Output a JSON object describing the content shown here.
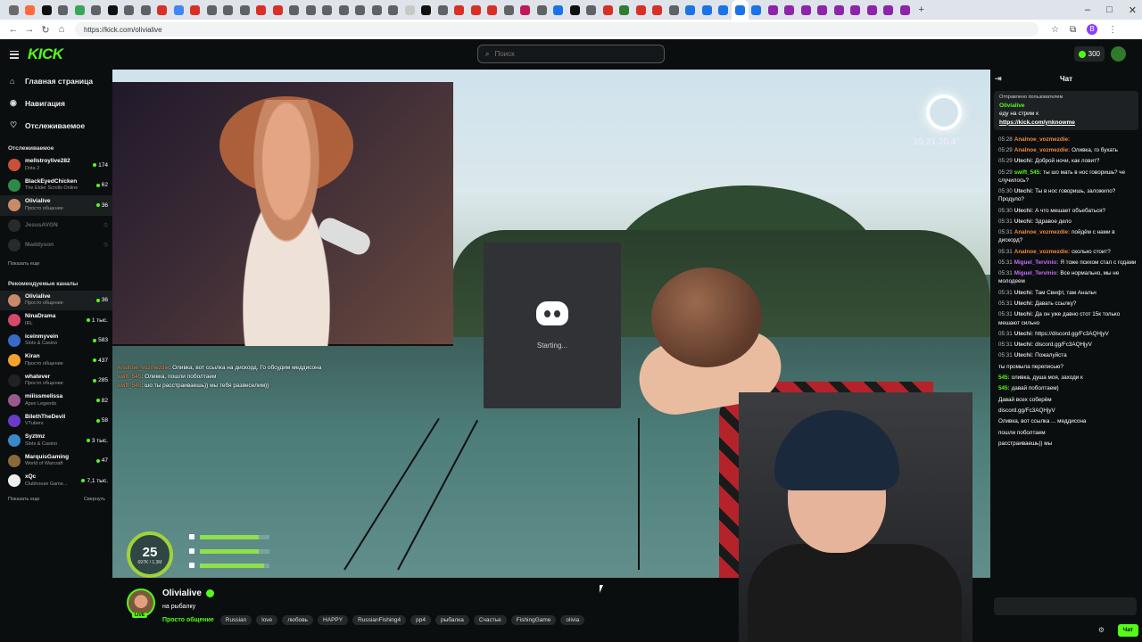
{
  "browser": {
    "tab_colors": [
      "#6b6b6b",
      "#ff6a3d",
      "#111111",
      "#5f6368",
      "#3aa657",
      "#5f6368",
      "#111111",
      "#5f6368",
      "#5f6368",
      "#d93025",
      "#4285f4",
      "#d93025",
      "#5f6368",
      "#5f6368",
      "#5f6368",
      "#d93025",
      "#d93025",
      "#5f6368",
      "#5f6368",
      "#5f6368",
      "#5f6368",
      "#5f6368",
      "#5f6368",
      "#5f6368",
      "#c8c8c8",
      "#111111",
      "#5f6368",
      "#d93025",
      "#d93025",
      "#d93025",
      "#5f6368",
      "#c2185b",
      "#5f6368",
      "#1a73e8",
      "#111111",
      "#5f6368",
      "#d93025",
      "#2e7d32",
      "#d93025",
      "#d93025",
      "#5f6368",
      "#1a73e8",
      "#1a73e8",
      "#1a73e8",
      "#1a73e8",
      "#1a73e8",
      "#8e24aa",
      "#8e24aa",
      "#8e24aa",
      "#8e24aa",
      "#8e24aa",
      "#8e24aa",
      "#8e24aa",
      "#8e24aa",
      "#8e24aa"
    ],
    "active_tab_index": 44,
    "new_tab_label": "+",
    "url": "https://kick.com/olivialive"
  },
  "header": {
    "logo": "KICK",
    "search_placeholder": "Поиск",
    "coins": "300"
  },
  "sidebar": {
    "nav": [
      {
        "label": "Главная страница",
        "icon": "home-icon"
      },
      {
        "label": "Навигация",
        "icon": "compass-icon"
      },
      {
        "label": "Отслеживаемое",
        "icon": "heart-icon"
      }
    ],
    "following_title": "Отслеживаемое",
    "following": [
      {
        "name": "mellstroylive282",
        "game": "Dota 2",
        "viewers": "174",
        "color": "#c9503a",
        "offline": false,
        "selected": false
      },
      {
        "name": "BlackEyedChicken",
        "game": "The Elder Scrolls Online",
        "viewers": "62",
        "color": "#2f8a4a",
        "offline": false,
        "selected": false
      },
      {
        "name": "Olivialive",
        "game": "Просто общение",
        "viewers": "36",
        "color": "#c98a6a",
        "offline": false,
        "selected": true
      },
      {
        "name": "JesusAVGN",
        "game": "",
        "viewers": "",
        "color": "#555555",
        "offline": true,
        "selected": false
      },
      {
        "name": "Maddyson",
        "game": "",
        "viewers": "",
        "color": "#555555",
        "offline": true,
        "selected": false
      }
    ],
    "show_more": "Показать еще",
    "recommended_title": "Рекомендуемые каналы",
    "recommended": [
      {
        "name": "Olivialive",
        "game": "Просто общение",
        "viewers": "36",
        "color": "#c98a6a",
        "selected": true
      },
      {
        "name": "NinaDrama",
        "game": "IRL",
        "viewers": "1 тыс.",
        "color": "#d44a6a",
        "selected": false
      },
      {
        "name": "iceinmyvein",
        "game": "Slots & Casino",
        "viewers": "583",
        "color": "#3a6ac9",
        "selected": false
      },
      {
        "name": "Kiran",
        "game": "Просто общение",
        "viewers": "437",
        "color": "#f2a22e",
        "selected": false
      },
      {
        "name": "whatever",
        "game": "Просто общение",
        "viewers": "285",
        "color": "#222222",
        "selected": false
      },
      {
        "name": "miiissmelissa",
        "game": "Apex Legends",
        "viewers": "82",
        "color": "#9a5a8a",
        "selected": false
      },
      {
        "name": "BilethTheDevil",
        "game": "VTubers",
        "viewers": "58",
        "color": "#6a3ac9",
        "selected": false
      },
      {
        "name": "Syztmz",
        "game": "Slots & Casino",
        "viewers": "3 тыс.",
        "color": "#3a8ac9",
        "selected": false
      },
      {
        "name": "MarquisGaming",
        "game": "World of Warcraft",
        "viewers": "47",
        "color": "#8a6a3a",
        "selected": false
      },
      {
        "name": "xQc",
        "game": "Clubhouse Game...",
        "viewers": "7,1 тыс.",
        "color": "#eeeeee",
        "selected": false
      }
    ],
    "show_more_2": "Показать еще",
    "collapse": "Свернуть"
  },
  "player": {
    "overlay_chat": [
      {
        "user": "Analnoe_vozmezdie",
        "text": ": Оливка, вот ссылка на дискорд. Го обсудим меддисона"
      },
      {
        "user": "swift_545",
        "text": ": Оливка, пошли поболтаем"
      },
      {
        "user": "swift_545",
        "text": ": шо ты расстраиваешь)) мы тебя развеселим))"
      }
    ],
    "discord_status": "Starting...",
    "game_time": "15:21",
    "game_temp": "20,4°",
    "hud_level": "25",
    "hud_sub": "697K / 1,3M",
    "hud_bars": [
      {
        "name": "energy",
        "icon": "bolt-icon",
        "fill": 0.85
      },
      {
        "name": "food",
        "icon": "fork-icon",
        "fill": 0.85
      },
      {
        "name": "health",
        "icon": "heart-icon",
        "fill": 0.92
      }
    ]
  },
  "stream_info": {
    "name": "Olivialive",
    "live_badge": "LIVE",
    "title": "на рыбалку",
    "category": "Просто общение",
    "tags": [
      "Russian",
      "love",
      "любовь",
      "HAPPY",
      "RussianFishing4",
      "pp4",
      "рыбалка",
      "Счастье",
      "FishingGame",
      "olivia"
    ]
  },
  "chat": {
    "title": "Чат",
    "pinned_header": "Отправлено пользователем",
    "pinned_user": "Olivialive",
    "pinned_text": "еду на стрим к",
    "pinned_link": "https://kick.com/ynknowme",
    "messages": [
      {
        "time": "05:28",
        "user": "Analnoe_vozmezdie",
        "color": "#f08a3a",
        "text": ""
      },
      {
        "time": "05:29",
        "user": "Analnoe_vozmezdie",
        "color": "#f08a3a",
        "text": "Оливка, го бухать"
      },
      {
        "time": "05:29",
        "user": "Utechi",
        "color": "#dddddd",
        "text": "Доброй ночи, как ловит?"
      },
      {
        "time": "05:29",
        "user": "swift_545",
        "color": "#53fc18",
        "text": "ты шо мать в нос говоришь? че случилось?"
      },
      {
        "time": "05:30",
        "user": "Utechi",
        "color": "#dddddd",
        "text": "Ты в нос говоришь, заложило? Продуло?"
      },
      {
        "time": "05:30",
        "user": "Utechi",
        "color": "#dddddd",
        "text": "А что мешает объебаться?"
      },
      {
        "time": "05:31",
        "user": "Utechi",
        "color": "#dddddd",
        "text": "Здравое дело"
      },
      {
        "time": "05:31",
        "user": "Analnoe_vozmezdie",
        "color": "#f08a3a",
        "text": "пойдём с нами в дискорд?"
      },
      {
        "time": "05:31",
        "user": "Analnoe_vozmezdie",
        "color": "#f08a3a",
        "text": "сколько стоит?"
      },
      {
        "time": "05:31",
        "user": "Miguel_Tervinio",
        "color": "#c86bff",
        "text": "Я тоже психом стал с годами"
      },
      {
        "time": "05:31",
        "user": "Miguel_Tervinio",
        "color": "#c86bff",
        "text": "Все нормально, мы не молодеем"
      },
      {
        "time": "05:31",
        "user": "Utechi",
        "color": "#dddddd",
        "text": "Там Свифт, там Анальч"
      },
      {
        "time": "05:31",
        "user": "Utechi",
        "color": "#dddddd",
        "text": "Давать ссылку?"
      },
      {
        "time": "05:31",
        "user": "Utechi",
        "color": "#dddddd",
        "text": "Да он уже давно стот 15к только мешают сильно"
      },
      {
        "time": "05:31",
        "user": "Utechi",
        "color": "#dddddd",
        "text": "https://discord.gg/Fc3AQHjyV"
      },
      {
        "time": "05:31",
        "user": "Utechi",
        "color": "#dddddd",
        "text": "discord.gg/Fc3AQHjyV"
      },
      {
        "time": "05:31",
        "user": "Utechi",
        "color": "#dddddd",
        "text": "Пожалуйста"
      },
      {
        "time": "",
        "user": "",
        "color": "#dddddd",
        "text": "ты промыла переписью?"
      },
      {
        "time": "",
        "user": "545",
        "color": "#53fc18",
        "text": "оливка, душа моя, заходи к"
      },
      {
        "time": "",
        "user": "545",
        "color": "#53fc18",
        "text": "давай поболтаем)"
      },
      {
        "time": "",
        "user": "",
        "color": "#dddddd",
        "text": "Давай всех соберём"
      },
      {
        "time": "",
        "user": "",
        "color": "#dddddd",
        "text": "discord.gg/Fc3AQHjyV"
      },
      {
        "time": "",
        "user": "",
        "color": "#f08a3a",
        "text": "Оливка, вот ссылка ... меддисона"
      },
      {
        "time": "",
        "user": "",
        "color": "#dddddd",
        "text": "пошли поболтаем"
      },
      {
        "time": "",
        "user": "",
        "color": "#dddddd",
        "text": "расстраиваешь)) мы"
      }
    ],
    "send_label": "Чат"
  }
}
